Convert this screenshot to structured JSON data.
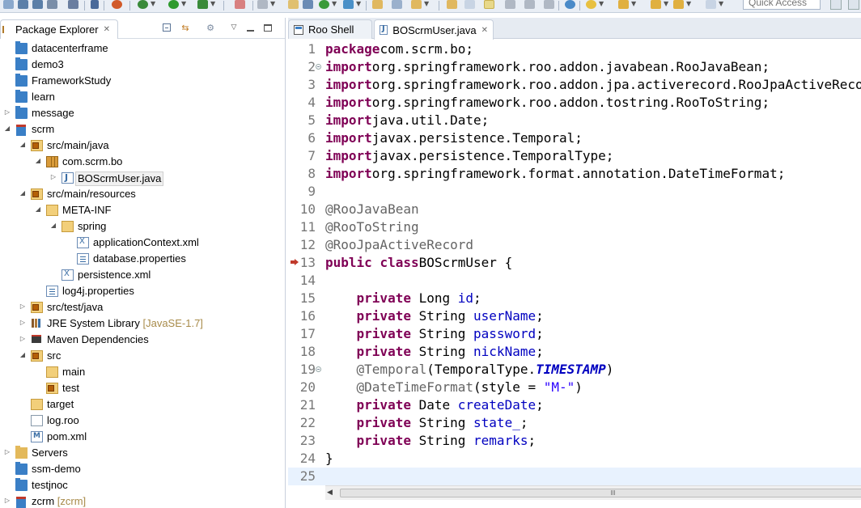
{
  "toolbar": {
    "quick_access_placeholder": "Quick Access"
  },
  "explorer": {
    "title": "Package Explorer",
    "close_glyph": "✕",
    "items": [
      {
        "label": "datacenterframe",
        "decor": "",
        "depth": 0,
        "twisty": "",
        "icon": "project-folder-icon"
      },
      {
        "label": "demo3",
        "decor": "",
        "depth": 0,
        "twisty": "",
        "icon": "project-folder-icon"
      },
      {
        "label": "FrameworkStudy",
        "decor": "",
        "depth": 0,
        "twisty": "",
        "icon": "project-folder-icon"
      },
      {
        "label": "learn",
        "decor": "",
        "depth": 0,
        "twisty": "",
        "icon": "project-folder-icon"
      },
      {
        "label": "message",
        "decor": "",
        "depth": 0,
        "twisty": "collapsed",
        "icon": "project-folder-icon"
      },
      {
        "label": "scrm",
        "decor": "",
        "depth": 0,
        "twisty": "expanded",
        "icon": "roo-project-icon"
      },
      {
        "label": "src/main/java",
        "decor": "",
        "depth": 1,
        "twisty": "expanded",
        "icon": "source-folder-icon"
      },
      {
        "label": "com.scrm.bo",
        "decor": "",
        "depth": 2,
        "twisty": "expanded",
        "icon": "package-icon"
      },
      {
        "label": "BOScrmUser.java",
        "decor": "",
        "depth": 3,
        "twisty": "collapsed",
        "icon": "java-file-icon",
        "selected": true
      },
      {
        "label": "src/main/resources",
        "decor": "",
        "depth": 1,
        "twisty": "expanded",
        "icon": "source-folder-icon"
      },
      {
        "label": "META-INF",
        "decor": "",
        "depth": 2,
        "twisty": "expanded",
        "icon": "folder-open-icon"
      },
      {
        "label": "spring",
        "decor": "",
        "depth": 3,
        "twisty": "expanded",
        "icon": "folder-open-icon"
      },
      {
        "label": "applicationContext.xml",
        "decor": "",
        "depth": 4,
        "twisty": "",
        "icon": "xml-file-icon"
      },
      {
        "label": "database.properties",
        "decor": "",
        "depth": 4,
        "twisty": "",
        "icon": "properties-file-icon"
      },
      {
        "label": "persistence.xml",
        "decor": "",
        "depth": 3,
        "twisty": "",
        "icon": "xml-file-icon"
      },
      {
        "label": "log4j.properties",
        "decor": "",
        "depth": 2,
        "twisty": "",
        "icon": "properties-file-icon"
      },
      {
        "label": "src/test/java",
        "decor": "",
        "depth": 1,
        "twisty": "collapsed",
        "icon": "source-folder-icon"
      },
      {
        "label": "JRE System Library",
        "decor": "[JavaSE-1.7]",
        "depth": 1,
        "twisty": "collapsed",
        "icon": "library-icon"
      },
      {
        "label": "Maven Dependencies",
        "decor": "",
        "depth": 1,
        "twisty": "collapsed",
        "icon": "maven-icon"
      },
      {
        "label": "src",
        "decor": "",
        "depth": 1,
        "twisty": "expanded",
        "icon": "source-folder-icon"
      },
      {
        "label": "main",
        "decor": "",
        "depth": 2,
        "twisty": "",
        "icon": "folder-open-icon"
      },
      {
        "label": "test",
        "decor": "",
        "depth": 2,
        "twisty": "",
        "icon": "source-folder-icon"
      },
      {
        "label": "target",
        "decor": "",
        "depth": 1,
        "twisty": "",
        "icon": "folder-open-icon"
      },
      {
        "label": "log.roo",
        "decor": "",
        "depth": 1,
        "twisty": "",
        "icon": "file-icon"
      },
      {
        "label": "pom.xml",
        "decor": "",
        "depth": 1,
        "twisty": "",
        "icon": "pom-file-icon"
      },
      {
        "label": "Servers",
        "decor": "",
        "depth": 0,
        "twisty": "collapsed",
        "icon": "servers-folder-icon"
      },
      {
        "label": "ssm-demo",
        "decor": "",
        "depth": 0,
        "twisty": "",
        "icon": "project-folder-icon"
      },
      {
        "label": "testjnoc",
        "decor": "",
        "depth": 0,
        "twisty": "",
        "icon": "project-folder-icon"
      },
      {
        "label": "zcrm",
        "decor": "[zcrm]",
        "depth": 0,
        "twisty": "collapsed",
        "icon": "roo-project-icon"
      }
    ]
  },
  "editor": {
    "tabs": [
      {
        "label": "Roo Shell",
        "active": false,
        "icon": "roo-shell-icon"
      },
      {
        "label": "BOScrmUser.java",
        "active": true,
        "icon": "java-file-icon",
        "close_glyph": "✕"
      }
    ],
    "current_line": 25,
    "lines": [
      {
        "n": "1",
        "marker": "",
        "tokens": [
          [
            "kw",
            "package"
          ],
          [
            "",
            "com.scrm.bo;"
          ]
        ]
      },
      {
        "n": "2",
        "marker": "fold",
        "tokens": [
          [
            "kw",
            "import"
          ],
          [
            "",
            "org.springframework.roo.addon.javabean.RooJavaBean;"
          ]
        ]
      },
      {
        "n": "3",
        "marker": "",
        "tokens": [
          [
            "kw",
            "import"
          ],
          [
            "",
            "org.springframework.roo.addon.jpa.activerecord.RooJpaActiveRecord;"
          ]
        ]
      },
      {
        "n": "4",
        "marker": "",
        "tokens": [
          [
            "kw",
            "import"
          ],
          [
            "",
            "org.springframework.roo.addon.tostring.RooToString;"
          ]
        ]
      },
      {
        "n": "5",
        "marker": "",
        "tokens": [
          [
            "kw",
            "import"
          ],
          [
            "",
            "java.util.Date;"
          ]
        ]
      },
      {
        "n": "6",
        "marker": "",
        "tokens": [
          [
            "kw",
            "import"
          ],
          [
            "",
            "javax.persistence.Temporal;"
          ]
        ]
      },
      {
        "n": "7",
        "marker": "",
        "tokens": [
          [
            "kw",
            "import"
          ],
          [
            "",
            "javax.persistence.TemporalType;"
          ]
        ]
      },
      {
        "n": "8",
        "marker": "",
        "tokens": [
          [
            "kw",
            "import"
          ],
          [
            "",
            "org.springframework.format.annotation.DateTimeFormat;"
          ]
        ]
      },
      {
        "n": "9",
        "marker": "",
        "tokens": []
      },
      {
        "n": "10",
        "marker": "",
        "tokens": [
          [
            "ann",
            "@RooJavaBean"
          ]
        ]
      },
      {
        "n": "11",
        "marker": "",
        "tokens": [
          [
            "ann",
            "@RooToString"
          ]
        ]
      },
      {
        "n": "12",
        "marker": "",
        "tokens": [
          [
            "ann",
            "@RooJpaActiveRecord"
          ]
        ]
      },
      {
        "n": "13",
        "marker": "override",
        "tokens": [
          [
            "kw",
            "public"
          ],
          [
            "",
            " "
          ],
          [
            "kw",
            "class"
          ],
          [
            "",
            "",
            " "
          ],
          [
            "",
            "BOScrmUser {"
          ]
        ]
      },
      {
        "n": "14",
        "marker": "",
        "tokens": []
      },
      {
        "n": "15",
        "marker": "",
        "tokens": [
          [
            "",
            "    "
          ],
          [
            "kw",
            "private"
          ],
          [
            "",
            " Long "
          ],
          [
            "field",
            "id"
          ],
          [
            "",
            ";"
          ]
        ]
      },
      {
        "n": "16",
        "marker": "",
        "tokens": [
          [
            "",
            "    "
          ],
          [
            "kw",
            "private"
          ],
          [
            "",
            " String "
          ],
          [
            "field",
            "userName"
          ],
          [
            "",
            ";"
          ]
        ]
      },
      {
        "n": "17",
        "marker": "",
        "tokens": [
          [
            "",
            "    "
          ],
          [
            "kw",
            "private"
          ],
          [
            "",
            " String "
          ],
          [
            "field",
            "password"
          ],
          [
            "",
            ";"
          ]
        ]
      },
      {
        "n": "18",
        "marker": "",
        "tokens": [
          [
            "",
            "    "
          ],
          [
            "kw",
            "private"
          ],
          [
            "",
            " String "
          ],
          [
            "field",
            "nickName"
          ],
          [
            "",
            ";"
          ]
        ]
      },
      {
        "n": "19",
        "marker": "fold",
        "tokens": [
          [
            "",
            "    "
          ],
          [
            "ann",
            "@Temporal"
          ],
          [
            "",
            "(TemporalType."
          ],
          [
            "stat",
            "TIMESTAMP"
          ],
          [
            "",
            ")"
          ]
        ]
      },
      {
        "n": "20",
        "marker": "",
        "tokens": [
          [
            "",
            "    "
          ],
          [
            "ann",
            "@DateTimeFormat"
          ],
          [
            "",
            "(style = "
          ],
          [
            "str",
            "\"M-\""
          ],
          [
            "",
            ")"
          ]
        ]
      },
      {
        "n": "21",
        "marker": "",
        "tokens": [
          [
            "",
            "    "
          ],
          [
            "kw",
            "private"
          ],
          [
            "",
            " Date "
          ],
          [
            "field",
            "createDate"
          ],
          [
            "",
            ";"
          ]
        ]
      },
      {
        "n": "22",
        "marker": "",
        "tokens": [
          [
            "",
            "    "
          ],
          [
            "kw",
            "private"
          ],
          [
            "",
            " String "
          ],
          [
            "field",
            "state_"
          ],
          [
            "",
            ";"
          ]
        ]
      },
      {
        "n": "23",
        "marker": "",
        "tokens": [
          [
            "",
            "    "
          ],
          [
            "kw",
            "private"
          ],
          [
            "",
            " String "
          ],
          [
            "field",
            "remarks"
          ],
          [
            "",
            ";"
          ]
        ]
      },
      {
        "n": "24",
        "marker": "",
        "tokens": [
          [
            "",
            "}"
          ]
        ]
      },
      {
        "n": "25",
        "marker": "",
        "tokens": []
      }
    ]
  }
}
